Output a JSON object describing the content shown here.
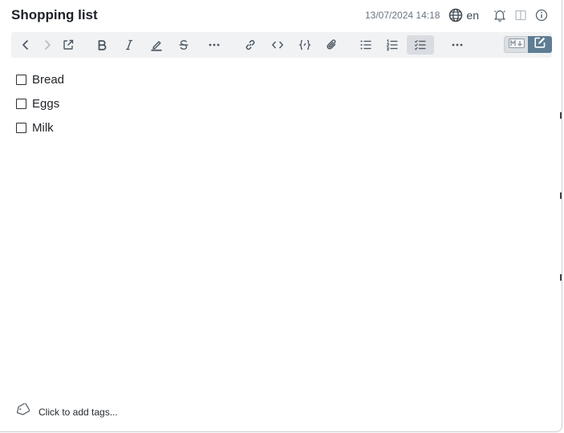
{
  "note": {
    "title": "Shopping list",
    "timestamp": "13/07/2024 14:18",
    "language": "en"
  },
  "header_icons": [
    "globe-icon",
    "bell-icon",
    "split-view-icon",
    "info-icon"
  ],
  "toolbar": {
    "buttons": [
      "back",
      "forward",
      "open-external",
      "bold",
      "italic",
      "highlight",
      "strikethrough",
      "more-format",
      "link",
      "inline-code",
      "code-block",
      "attachment",
      "bullet-list",
      "numbered-list",
      "task-list",
      "more-insert"
    ],
    "active": "task-list",
    "mode": "edit"
  },
  "checklist": [
    {
      "text": "Bread",
      "checked": false
    },
    {
      "text": "Eggs",
      "checked": false
    },
    {
      "text": "Milk",
      "checked": false
    }
  ],
  "tags": {
    "placeholder": "Click to add tags..."
  },
  "colors": {
    "toolbar_bg": "#f0f2f4",
    "icon": "#4a5560",
    "active_mode": "#5f7d94",
    "timestamp": "#6a7581"
  }
}
